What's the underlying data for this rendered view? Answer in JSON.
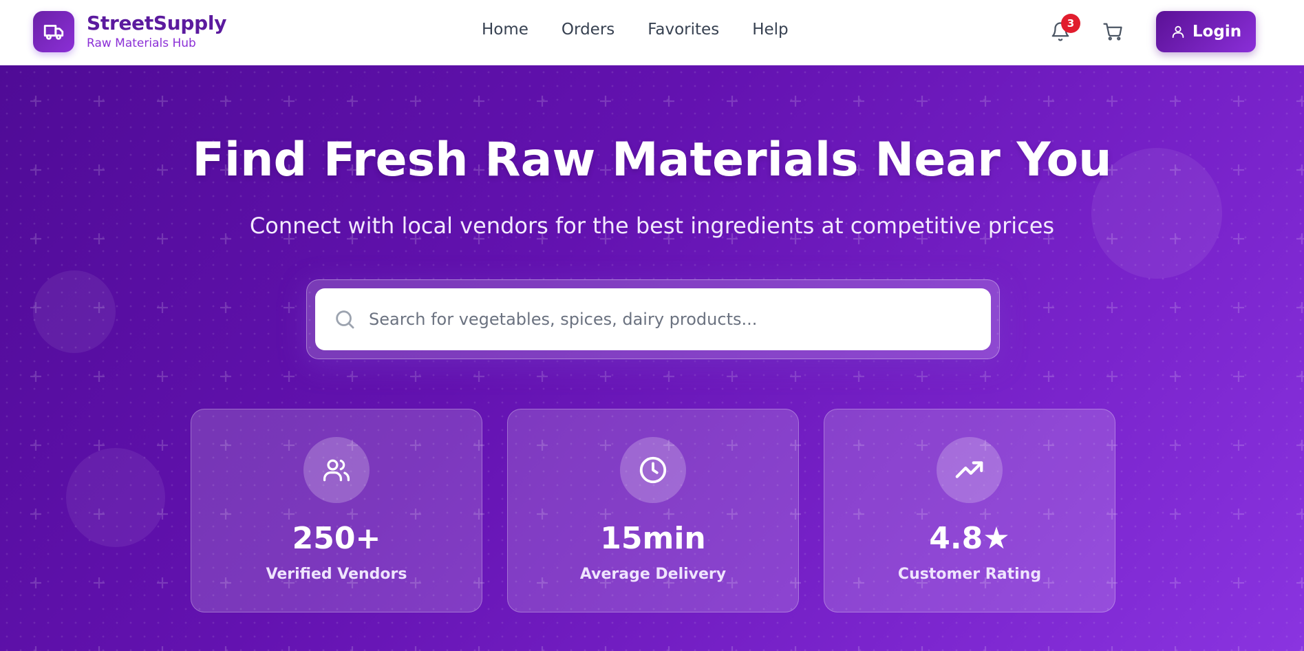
{
  "brand": {
    "title": "StreetSupply",
    "subtitle": "Raw Materials Hub",
    "logo_icon": "truck-icon"
  },
  "nav": {
    "links": [
      "Home",
      "Orders",
      "Favorites",
      "Help"
    ]
  },
  "actions": {
    "notifications_count": "3",
    "notification_icon": "bell-icon",
    "cart_icon": "shopping-cart-icon",
    "login_label": "Login",
    "login_icon": "user-icon"
  },
  "hero": {
    "title": "Find Fresh Raw Materials Near You",
    "subtitle": "Connect with local vendors for the best ingredients at competitive prices"
  },
  "search": {
    "placeholder": "Search for vegetables, spices, dairy products...",
    "icon": "search-icon"
  },
  "stats": [
    {
      "value": "250+",
      "label": "Verified Vendors",
      "icon": "users-icon"
    },
    {
      "value": "15min",
      "label": "Average Delivery",
      "icon": "clock-icon"
    },
    {
      "value": "4.8★",
      "label": "Customer Rating",
      "icon": "trending-up-icon"
    }
  ],
  "colors": {
    "brand_purple": "#5b1a9e",
    "accent_purple": "#8b2fd6",
    "hero_start": "#4f0b96",
    "hero_end": "#8a34e0",
    "badge_red": "#e11d2e"
  }
}
